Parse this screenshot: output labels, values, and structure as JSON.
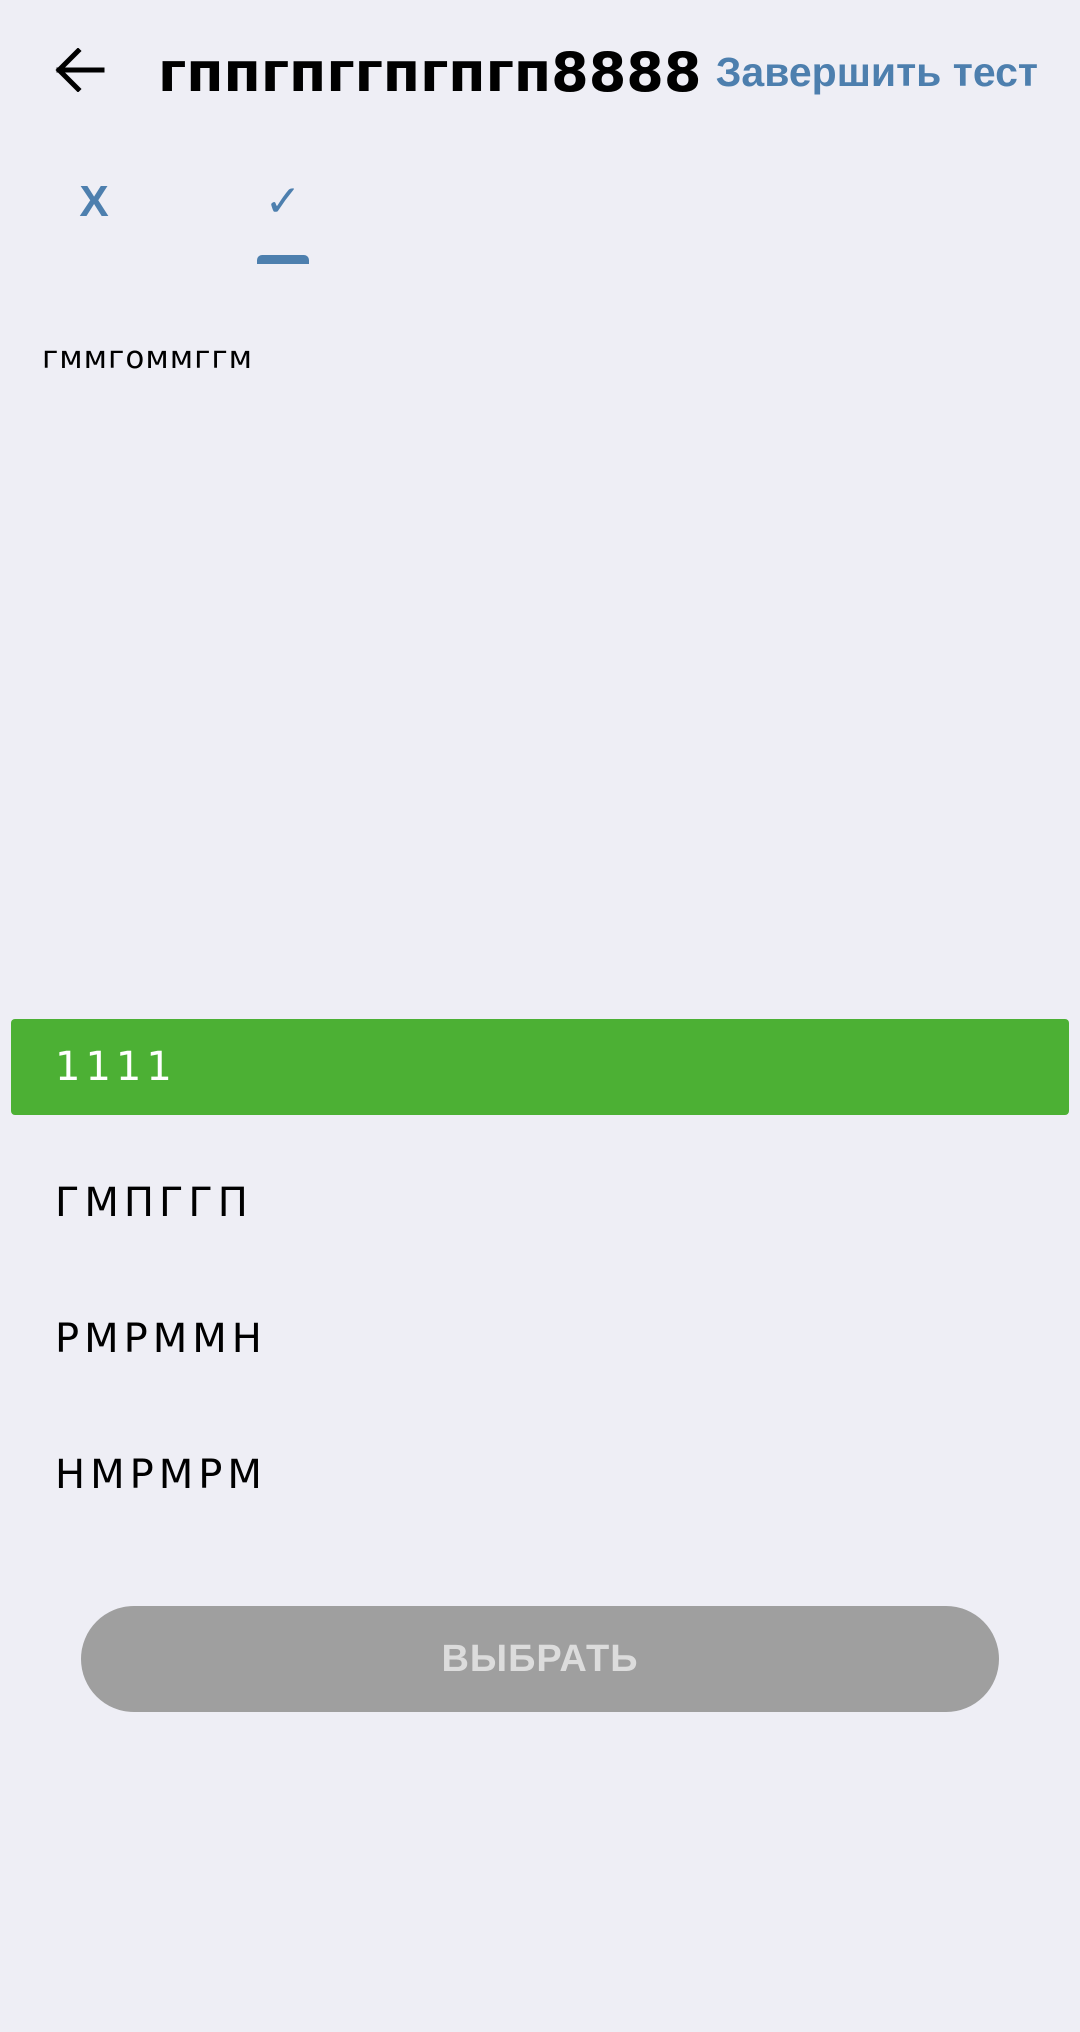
{
  "header": {
    "title": "гппгпггпгпгп8888",
    "finish_label": "Завершить тест"
  },
  "tabs": [
    {
      "label": "X",
      "active": false
    },
    {
      "label": "✓",
      "active": true
    }
  ],
  "question": {
    "text": "гммгоммггм"
  },
  "options": [
    {
      "label": "1111",
      "selected": true
    },
    {
      "label": "ГМПГГП",
      "selected": false
    },
    {
      "label": "РМРММН",
      "selected": false
    },
    {
      "label": "НМРМРМ",
      "selected": false
    }
  ],
  "action": {
    "choose_label": "ВЫБРАТЬ",
    "enabled": false
  },
  "colors": {
    "background": "#eeeef5",
    "accent": "#4d7fae",
    "selected": "#4cb034",
    "button_disabled": "#9f9f9f"
  }
}
